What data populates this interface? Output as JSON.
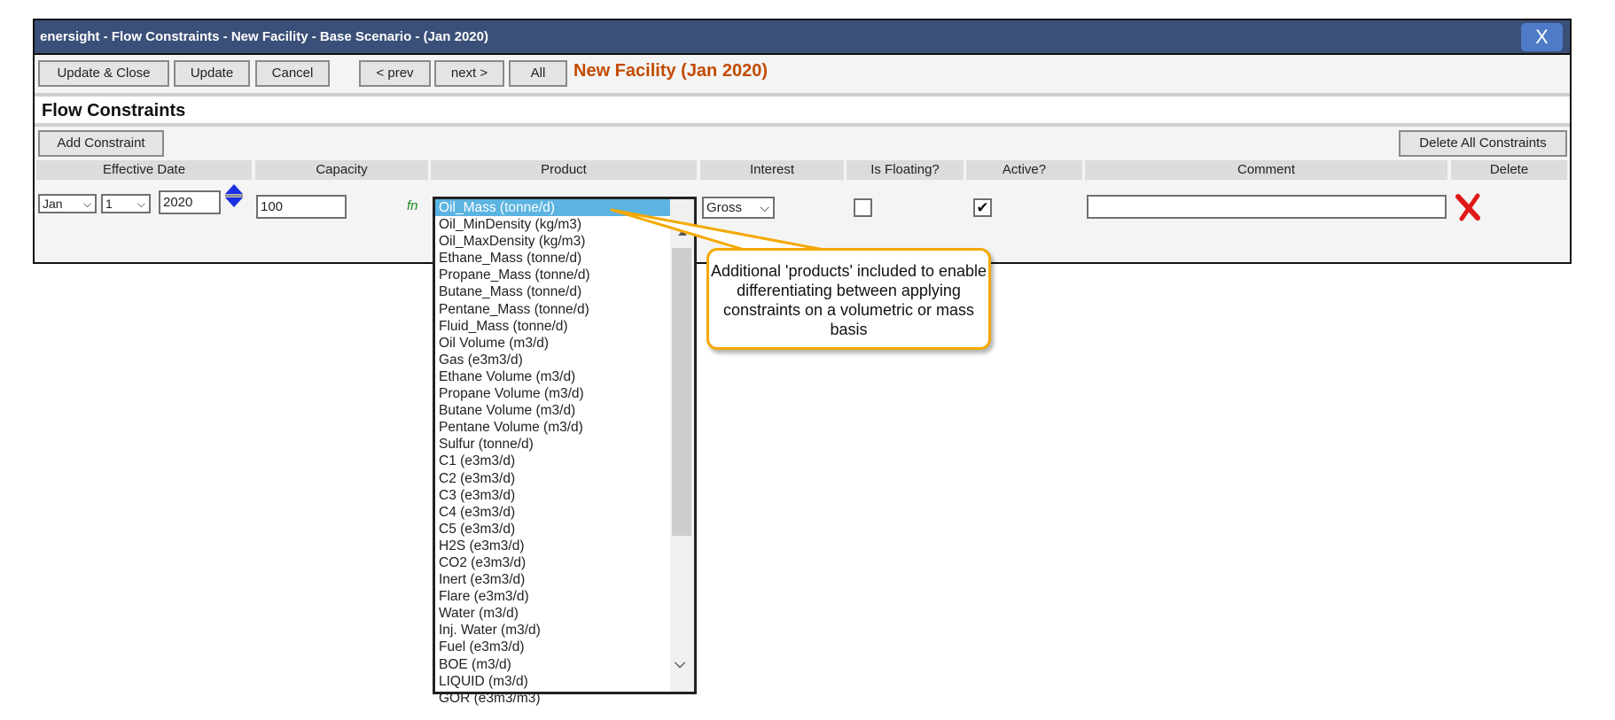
{
  "window": {
    "title": "enersight - Flow Constraints - New Facility - Base Scenario - (Jan 2020)",
    "close_label": "X"
  },
  "toolbar": {
    "update_close": "Update & Close",
    "update": "Update",
    "cancel": "Cancel",
    "prev": "< prev",
    "next": "next >",
    "all": "All",
    "facility_label": "New Facility (Jan 2020)"
  },
  "section": {
    "heading": "Flow Constraints",
    "add_label": "Add Constraint",
    "delete_all_label": "Delete All Constraints"
  },
  "columns": [
    "Effective Date",
    "Capacity",
    "Product",
    "Interest",
    "Is Floating?",
    "Active?",
    "Comment",
    "Delete"
  ],
  "row": {
    "month": "Jan",
    "day": "1",
    "year": "2020",
    "capacity": "100",
    "fn_label": "fn",
    "interest": "Gross",
    "is_floating": false,
    "active": true,
    "comment": ""
  },
  "products": [
    "Oil_Mass (tonne/d)",
    "Oil_MinDensity (kg/m3)",
    "Oil_MaxDensity (kg/m3)",
    "Ethane_Mass (tonne/d)",
    "Propane_Mass (tonne/d)",
    "Butane_Mass (tonne/d)",
    "Pentane_Mass (tonne/d)",
    "Fluid_Mass (tonne/d)",
    "Oil Volume (m3/d)",
    "Gas (e3m3/d)",
    "Ethane Volume (m3/d)",
    "Propane Volume (m3/d)",
    "Butane Volume (m3/d)",
    "Pentane Volume (m3/d)",
    "Sulfur (tonne/d)",
    "C1 (e3m3/d)",
    "C2 (e3m3/d)",
    "C3 (e3m3/d)",
    "C4 (e3m3/d)",
    "C5 (e3m3/d)",
    "H2S (e3m3/d)",
    "CO2 (e3m3/d)",
    "Inert (e3m3/d)",
    "Flare (e3m3/d)",
    "Water (m3/d)",
    "Inj. Water (m3/d)",
    "Fuel (e3m3/d)",
    "BOE (m3/d)",
    "LIQUID (m3/d)",
    "GOR (e3m3/m3)"
  ],
  "selected_product": "Oil_Mass (tonne/d)",
  "callout": {
    "text": "Additional 'products' included to enable differentiating between applying constraints on a volumetric or mass basis"
  },
  "colors": {
    "titlebar": "#3b5078",
    "accent": "#c24a00",
    "highlight": "#5bb4e2",
    "callout_border": "#f5a800"
  }
}
